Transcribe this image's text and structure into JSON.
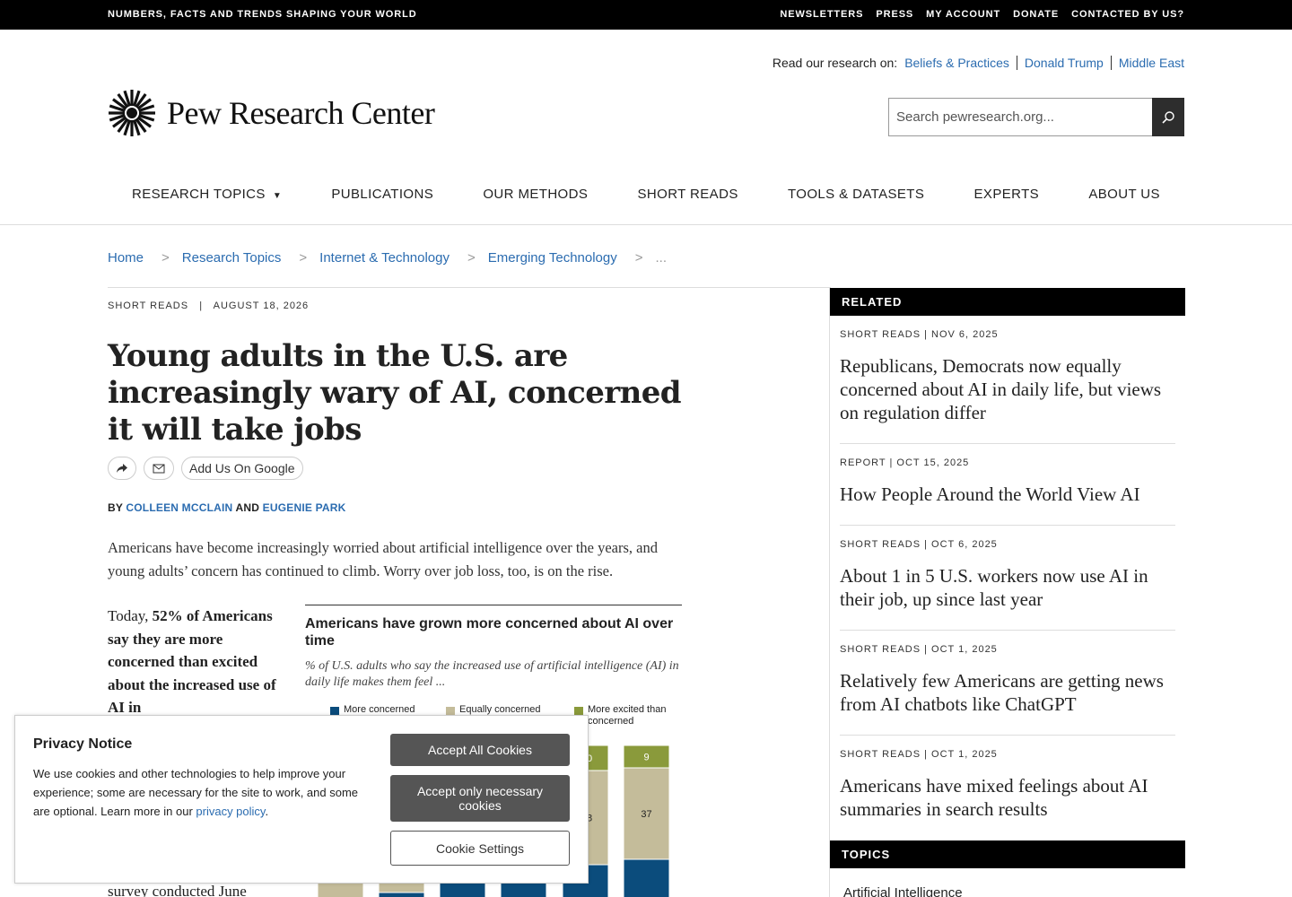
{
  "topbar": {
    "tagline": "NUMBERS, FACTS AND TRENDS SHAPING YOUR WORLD",
    "links": [
      "NEWSLETTERS",
      "PRESS",
      "MY ACCOUNT",
      "DONATE",
      "CONTACTED BY US?"
    ]
  },
  "header": {
    "research_label": "Read our research on:",
    "research_links": [
      "Beliefs & Practices",
      "Donald Trump",
      "Middle East"
    ],
    "logo_text": "Pew Research Center",
    "search_placeholder": "Search pewresearch.org..."
  },
  "nav": {
    "items": [
      "RESEARCH TOPICS",
      "PUBLICATIONS",
      "OUR METHODS",
      "SHORT READS",
      "TOOLS & DATASETS",
      "EXPERTS",
      "ABOUT US"
    ]
  },
  "breadcrumb": {
    "items": [
      "Home",
      "Research Topics",
      "Internet & Technology",
      "Emerging Technology"
    ],
    "separator": ">",
    "ellipsis": "..."
  },
  "article": {
    "category": "SHORT READS",
    "meta_sep": "|",
    "date": "AUGUST 18, 2026",
    "title": "Young adults in the U.S. are increasingly wary of AI, concerned it will take jobs",
    "add_google": "Add Us On Google",
    "by": "BY",
    "author1": "COLLEEN MCCLAIN",
    "and": "AND",
    "author2": "EUGENIE PARK",
    "lede": "Americans have become increasingly worried about artificial intelligence over the years, and young adults’ concern has continued to climb. Worry over job loss, too, is on the rise.",
    "pull_prefix": "Today, ",
    "pull_bold": "52% of Americans say they are more concerned than excited about the increased use of AI in",
    "pull_tail": "survey conducted June"
  },
  "chart": {
    "title": "Americans have grown more concerned about AI over time",
    "subtitle": "% of U.S. adults who say the increased use of artificial intelligence (AI) in daily life makes them feel ...",
    "legend": [
      {
        "label": "More concerned",
        "color": "#0b4c7c"
      },
      {
        "label": "Equally concerned",
        "color": "#c4bc9a"
      },
      {
        "label": "More excited than concerned",
        "color": "#8a9a3b"
      }
    ]
  },
  "chart_data": {
    "type": "bar",
    "stacked": true,
    "series": [
      {
        "name": "More concerned",
        "color": "#0b4c7c"
      },
      {
        "name": "Equally concerned",
        "color": "#c4bc9a"
      },
      {
        "name": "More excited than concerned",
        "color": "#8a9a3b"
      }
    ],
    "visible_labels": [
      {
        "bar": 5,
        "series": "More excited than concerned",
        "text": "9"
      },
      {
        "bar": 5,
        "series": "Equally concerned",
        "text": "37"
      },
      {
        "bar": 4,
        "series": "More excited than concerned",
        "text": "0"
      },
      {
        "bar": 4,
        "series": "Equally concerned",
        "text": "8"
      }
    ]
  },
  "related": {
    "heading": "RELATED",
    "items": [
      {
        "meta": "SHORT READS | NOV 6, 2025",
        "title": "Republicans, Democrats now equally concerned about AI in daily life, but views on regulation differ"
      },
      {
        "meta": "REPORT | OCT 15, 2025",
        "title": "How People Around the World View AI"
      },
      {
        "meta": "SHORT READS | OCT 6, 2025",
        "title": "About 1 in 5 U.S. workers now use AI in their job, up since last year"
      },
      {
        "meta": "SHORT READS | OCT 1, 2025",
        "title": "Relatively few Americans are getting news from AI chatbots like ChatGPT"
      },
      {
        "meta": "SHORT READS | OCT 1, 2025",
        "title": "Americans have mixed feelings about AI summaries in search results"
      }
    ]
  },
  "topics": {
    "heading": "TOPICS",
    "first": "Artificial Intelligence"
  },
  "privacy": {
    "title": "Privacy Notice",
    "text": "We use cookies and other technologies to help improve your experience; some are necessary for the site to work, and some are optional. Learn more in our ",
    "link": "privacy policy",
    "text_end": ".",
    "accept_all": "Accept All Cookies",
    "accept_necessary": "Accept only necessary cookies",
    "settings": "Cookie Settings"
  }
}
